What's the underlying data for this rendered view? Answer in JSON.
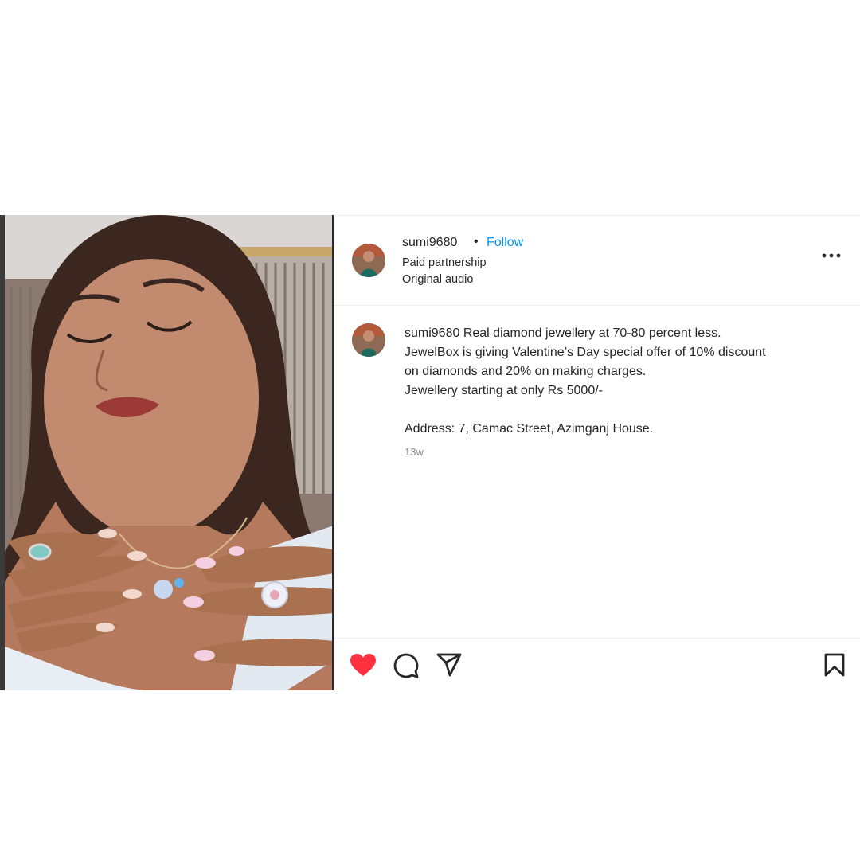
{
  "post": {
    "username": "sumi9680",
    "separator": "•",
    "follow_label": "Follow",
    "subtitle_partnership": "Paid partnership",
    "subtitle_audio": "Original audio",
    "more_icon": "more-options-icon",
    "caption": {
      "username": "sumi9680",
      "lines": [
        "Real diamond jewellery at 70-80 percent less.",
        "JewelBox is giving Valentine’s Day special offer of 10% discount",
        "on diamonds and 20% on making charges.",
        "Jewellery starting at only Rs 5000/-",
        "Address: 7, Camac Street, Azimganj House."
      ],
      "age": "13w"
    },
    "actions": {
      "like_icon": "heart-icon",
      "like_color": "#ff3040",
      "comment_icon": "comment-icon",
      "share_icon": "share-icon",
      "save_icon": "bookmark-icon"
    }
  }
}
